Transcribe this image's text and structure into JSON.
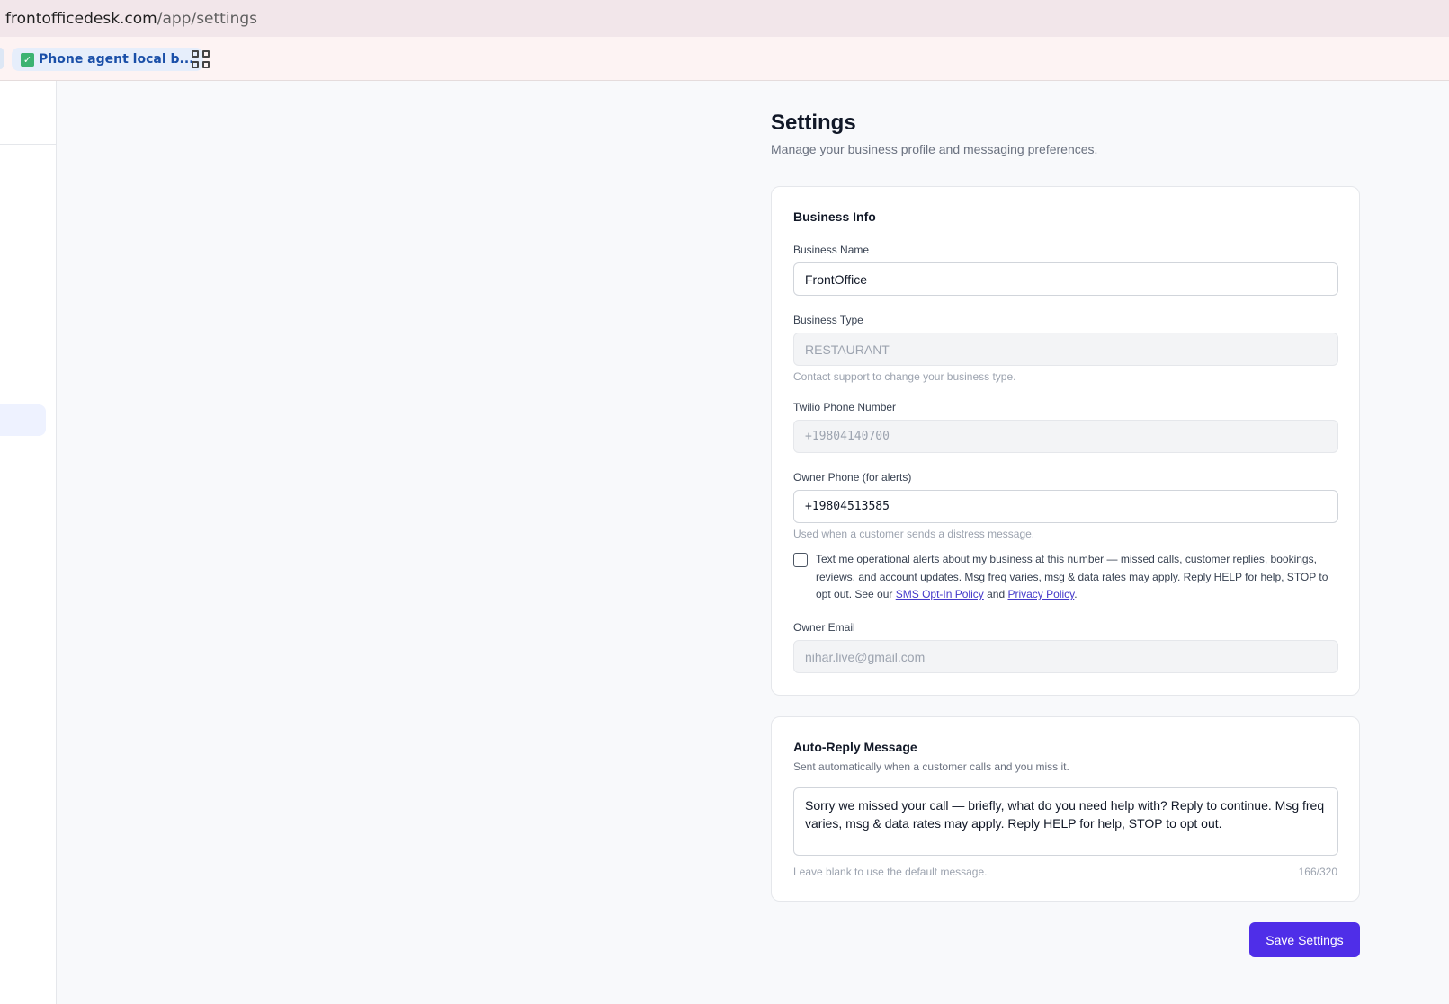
{
  "browser": {
    "url_host": "frontofficedesk.com",
    "url_path": "/app/settings",
    "bookmark_label": "Phone agent local b..."
  },
  "page": {
    "title": "Settings",
    "subtitle": "Manage your business profile and messaging preferences."
  },
  "business_info": {
    "title": "Business Info",
    "business_name_label": "Business Name",
    "business_name_value": "FrontOffice",
    "business_type_label": "Business Type",
    "business_type_value": "RESTAURANT",
    "business_type_hint": "Contact support to change your business type.",
    "twilio_label": "Twilio Phone Number",
    "twilio_value": "+19804140700",
    "owner_phone_label": "Owner Phone (for alerts)",
    "owner_phone_value": "+19804513585",
    "owner_phone_hint": "Used when a customer sends a distress message.",
    "alerts_checked": false,
    "consent_text_1": "Text me operational alerts about my business at this number — missed calls, customer replies, bookings, reviews, and account updates. Msg freq varies, msg & data rates may apply. Reply HELP for help, STOP to opt out. See our ",
    "sms_policy_link": "SMS Opt-In Policy",
    "consent_and": " and ",
    "privacy_policy_link": "Privacy Policy",
    "consent_end": ".",
    "owner_email_label": "Owner Email",
    "owner_email_value": "nihar.live@gmail.com"
  },
  "auto_reply": {
    "title": "Auto-Reply Message",
    "subtitle": "Sent automatically when a customer calls and you miss it.",
    "message": "Sorry we missed your call — briefly, what do you need help with? Reply to continue. Msg freq varies, msg & data rates may apply. Reply HELP for help, STOP to opt out.",
    "hint": "Leave blank to use the default message.",
    "counter": "166/320"
  },
  "actions": {
    "save_label": "Save Settings"
  },
  "colors": {
    "accent": "#4f2ee8",
    "link": "#4338ca"
  }
}
